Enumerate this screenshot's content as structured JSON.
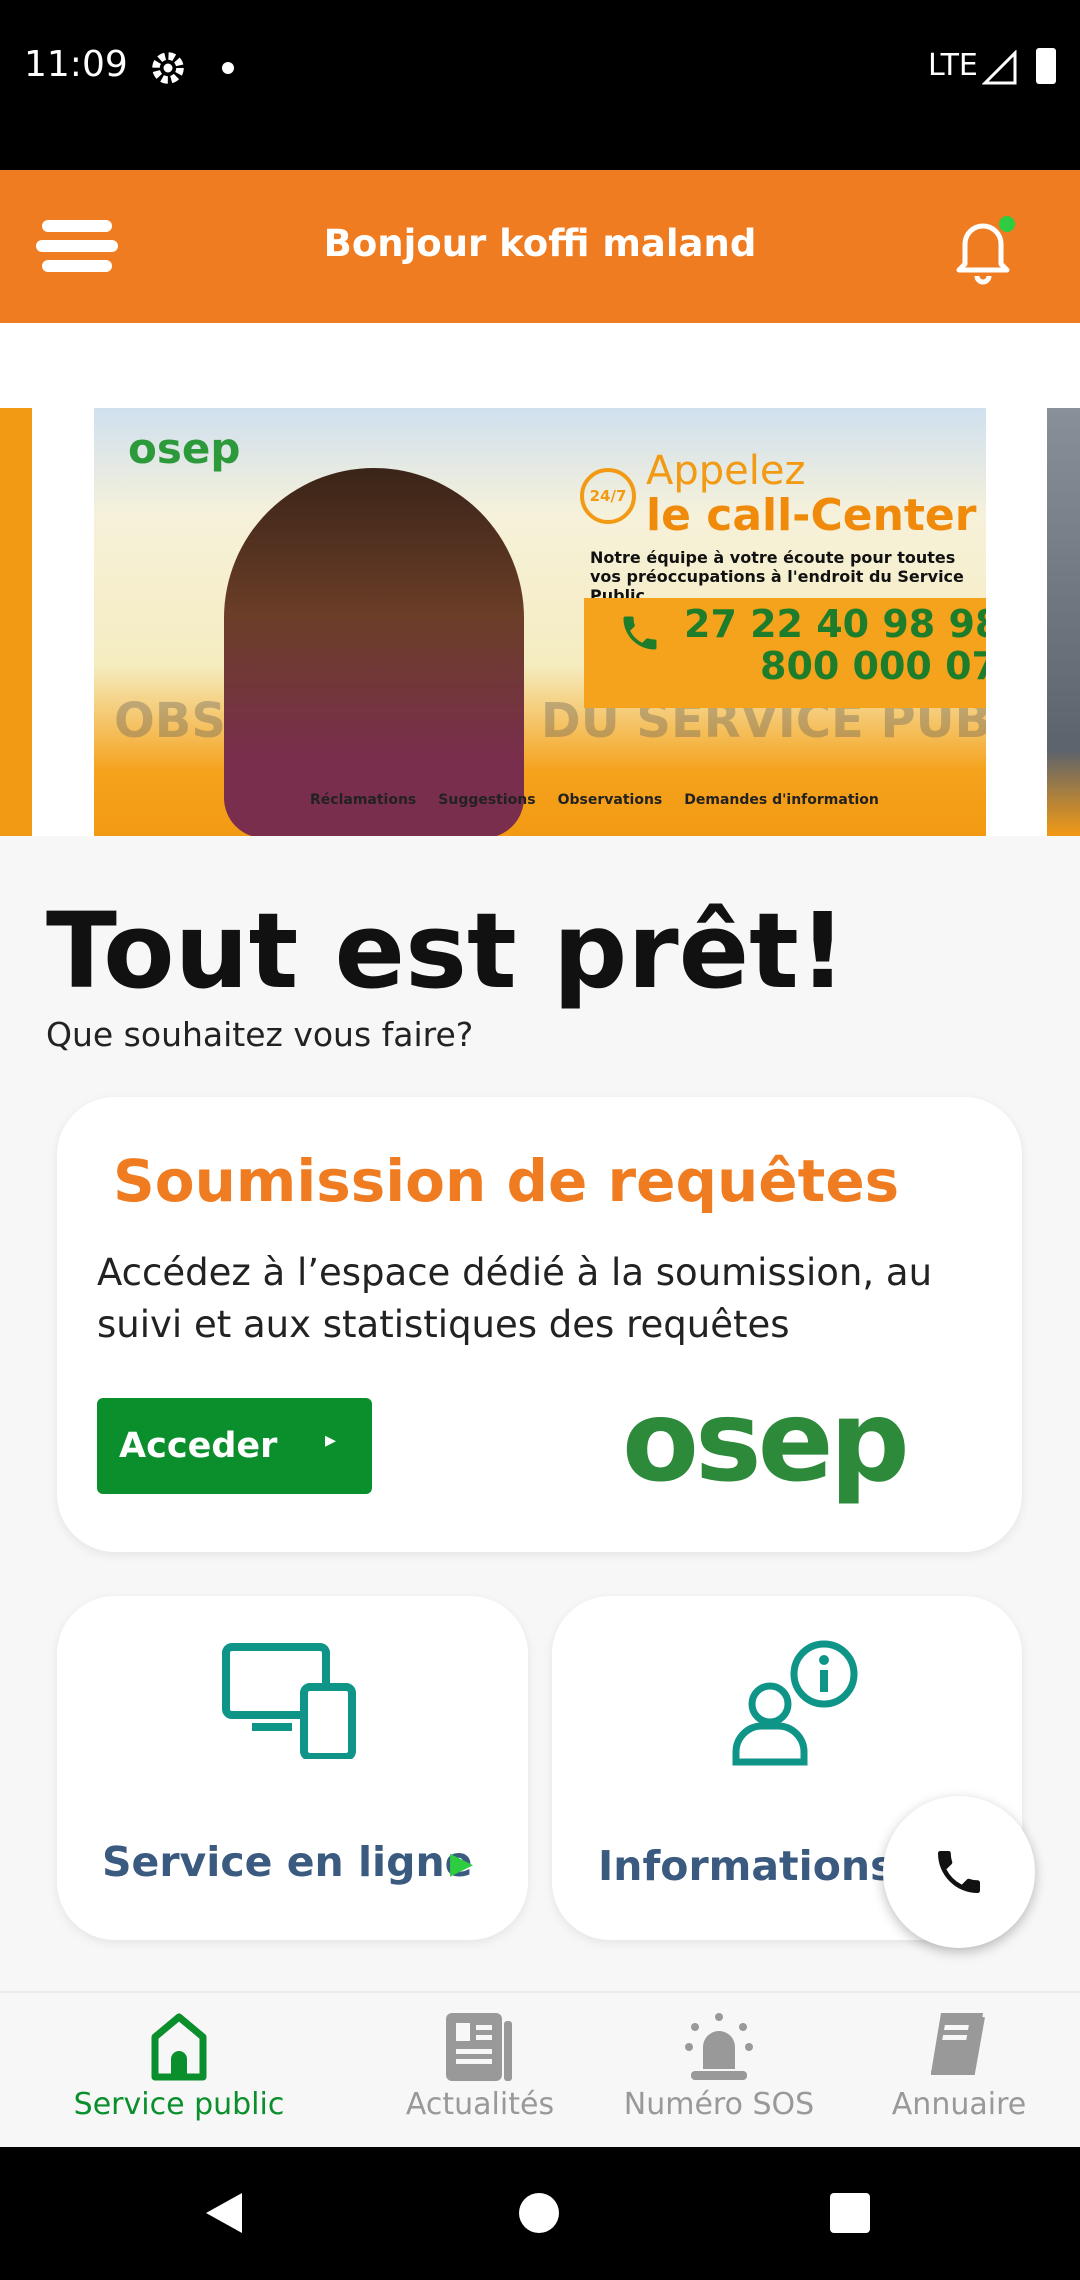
{
  "status_bar": {
    "time": "11:09",
    "network": "LTE"
  },
  "header": {
    "title": "Bonjour koffi maland",
    "notification_dot_color": "#2ecc40"
  },
  "banner": {
    "logo": "osep",
    "headline_1": "Appelez",
    "headline_2": "le call-Center",
    "badge": "24/7",
    "tagline": "Notre équipe à votre écoute pour toutes vos préoccupations à l'endroit du Service Public",
    "phone_1": "27 22 40 98 98",
    "phone_2": "800 000 07",
    "background_text": "OBSERVATOIRE DU SERVICE PUBLIC",
    "checks": [
      "Réclamations",
      "Suggestions",
      "Observations",
      "Demandes d'information"
    ]
  },
  "main": {
    "title": "Tout est prêt!",
    "subtitle": "Que souhaitez vous faire?",
    "request_card": {
      "title": "Soumission de requêtes",
      "description": " Accédez à l’espace dédié à la soumission, au suivi et aux statistiques des requêtes",
      "button": "Acceder",
      "logo": "osep"
    },
    "tiles": [
      {
        "label": "Service en ligne",
        "icon": "devices-icon"
      },
      {
        "label": "Informations",
        "icon": "user-info-icon"
      }
    ]
  },
  "bottom_nav": {
    "items": [
      {
        "label": "Service public",
        "active": true
      },
      {
        "label": "Actualités"
      },
      {
        "label": "Numéro SOS"
      },
      {
        "label": "Annuaire"
      }
    ]
  },
  "colors": {
    "accent": "#f07c22",
    "green": "#0a8f2c",
    "teal": "#0f9488",
    "tile_text": "#3a5a80"
  }
}
